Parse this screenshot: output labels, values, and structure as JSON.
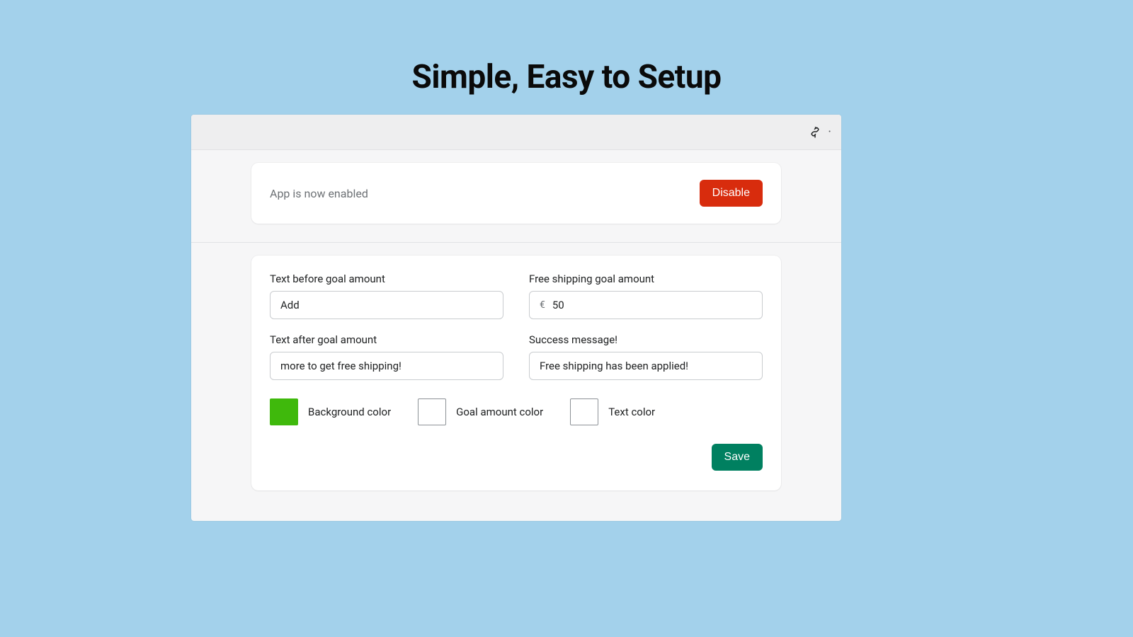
{
  "hero": {
    "title": "Simple, Easy to Setup"
  },
  "status": {
    "message": "App is now enabled",
    "disable_label": "Disable"
  },
  "form": {
    "text_before_label": "Text before goal amount",
    "text_before_value": "Add",
    "goal_amount_label": "Free shipping goal amount",
    "goal_amount_currency": "€",
    "goal_amount_value": "50",
    "text_after_label": "Text after goal amount",
    "text_after_value": "more to get free shipping!",
    "success_label": "Success message!",
    "success_value": "Free shipping has been applied!",
    "colors": {
      "background_label": "Background color",
      "background_value": "#3fb90c",
      "goal_amount_label": "Goal amount color",
      "goal_amount_value": "#ffffff",
      "text_label": "Text color",
      "text_value": "#ffffff"
    },
    "save_label": "Save"
  }
}
